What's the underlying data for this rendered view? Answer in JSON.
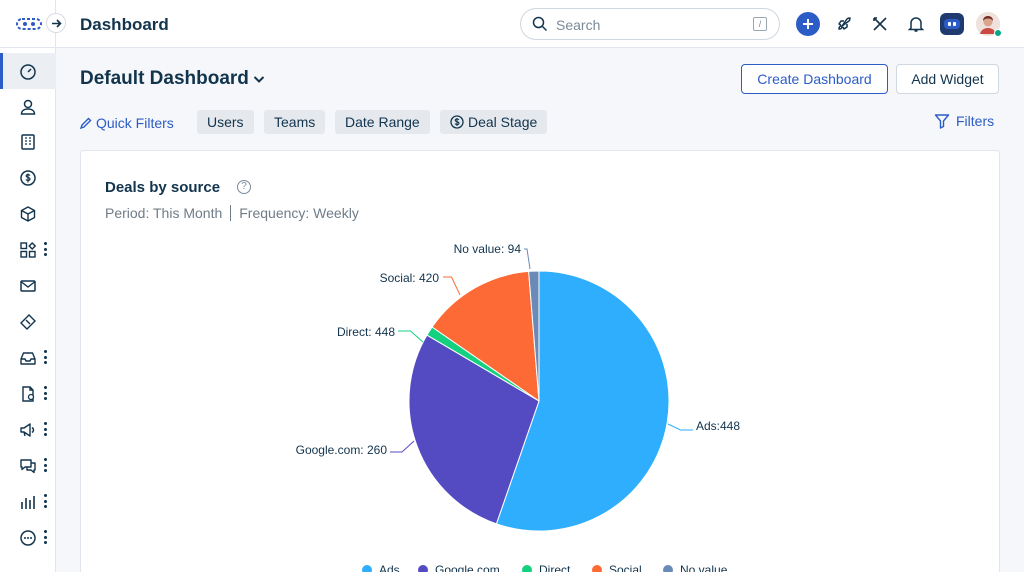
{
  "header": {
    "title": "Dashboard",
    "search_placeholder": "Search",
    "search_shortcut": "/"
  },
  "sidebar": {
    "items": [
      {
        "icon": "dashboard-icon",
        "active": true
      },
      {
        "icon": "contacts-icon"
      },
      {
        "icon": "accounts-icon"
      },
      {
        "icon": "deals-icon"
      },
      {
        "icon": "products-icon"
      },
      {
        "icon": "apps-icon",
        "more": true
      },
      {
        "icon": "email-icon"
      },
      {
        "icon": "tickets-icon"
      },
      {
        "icon": "inbox-icon",
        "more": true
      },
      {
        "icon": "documents-icon",
        "more": true
      },
      {
        "icon": "campaigns-icon",
        "more": true
      },
      {
        "icon": "chat-icon",
        "more": true
      },
      {
        "icon": "reports-icon",
        "more": true
      },
      {
        "icon": "more-icon",
        "more": true
      }
    ]
  },
  "dashboard": {
    "name": "Default Dashboard",
    "create_label": "Create Dashboard",
    "add_widget_label": "Add Widget",
    "quick_filters_label": "Quick Filters",
    "filter_chips": [
      "Users",
      "Teams",
      "Date Range",
      "Deal Stage"
    ],
    "filters_label": "Filters"
  },
  "widget": {
    "title": "Deals by source",
    "period": "Period: This Month",
    "frequency": "Frequency: Weekly"
  },
  "colors": {
    "accent": "#2c5cc5",
    "ads": "#2eaefc",
    "google": "#544bc3",
    "direct": "#13d17f",
    "social": "#fd6a35",
    "no_value": "#6a8bb8"
  },
  "chart_data": {
    "type": "pie",
    "title": "Deals by source",
    "slices": [
      {
        "name": "Ads",
        "value": 448,
        "label": "Ads:448",
        "color": "#2eaefc"
      },
      {
        "name": "Google.com",
        "value": 260,
        "label": "Google.com: 260",
        "color": "#544bc3"
      },
      {
        "name": "Direct",
        "value": 448,
        "label": "Direct: 448",
        "color": "#13d17f"
      },
      {
        "name": "Social",
        "value": 420,
        "label": "Social: 420",
        "color": "#fd6a35"
      },
      {
        "name": "No value",
        "value": 94,
        "label": "No value: 94",
        "color": "#6a8bb8"
      }
    ],
    "slice_fractions": [
      0.5531,
      0.2815,
      0.0118,
      0.1409,
      0.0127
    ],
    "legend": [
      "Ads",
      "Google.com",
      "Direct",
      "Social",
      "No value"
    ],
    "legend_position": "bottom"
  }
}
